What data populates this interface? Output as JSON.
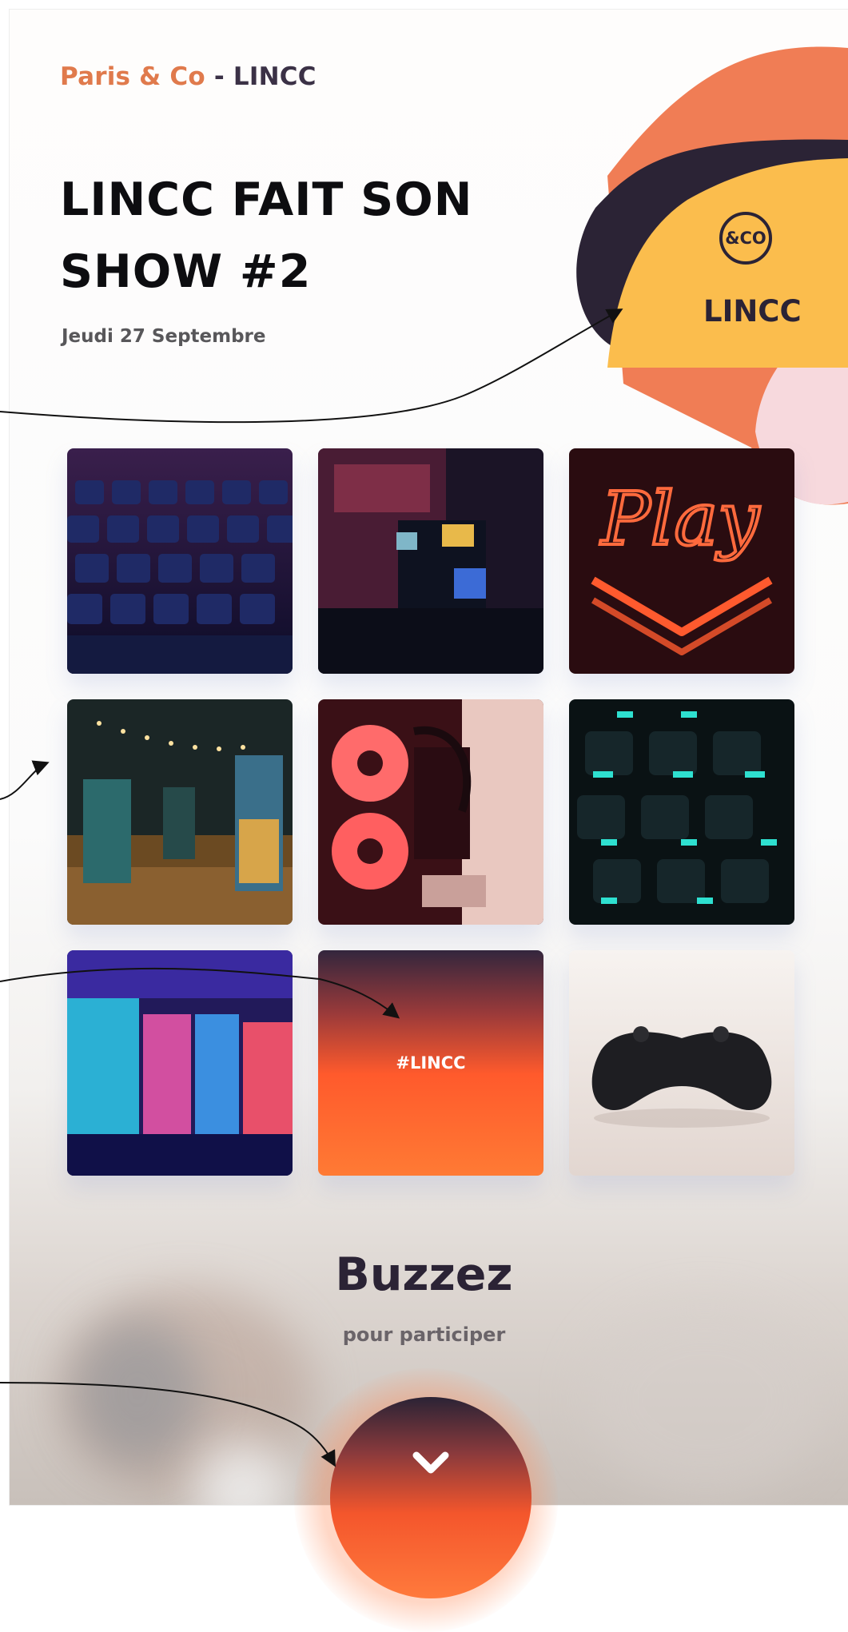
{
  "header": {
    "brand_main": "Paris & Co",
    "brand_sep": " - ",
    "brand_sub": "LINCC",
    "title_line1": "LINCC FAIT SON",
    "title_line2": "SHOW #2",
    "date": "Jeudi 27 Septembre"
  },
  "logo": {
    "mark": "&CO",
    "label": "LINCC",
    "colors": {
      "orange": "#f07d55",
      "navy": "#2b2335",
      "yellow": "#fbbd4d",
      "pink": "#f7d9dd"
    }
  },
  "gallery": {
    "tiles": [
      {
        "name": "keyboard-purple-photo"
      },
      {
        "name": "arcade-cabinet-photo"
      },
      {
        "name": "neon-play-sign-photo"
      },
      {
        "name": "arcade-hall-photo"
      },
      {
        "name": "pc-cooling-fans-photo"
      },
      {
        "name": "keyboard-teal-photo"
      },
      {
        "name": "claw-machines-photo"
      },
      {
        "name": "hashtag-tile",
        "text": "#LINCC"
      },
      {
        "name": "game-controller-photo"
      }
    ]
  },
  "cta": {
    "title": "Buzzez",
    "subtitle": "pour participer",
    "icon": "chevron-down-icon"
  }
}
